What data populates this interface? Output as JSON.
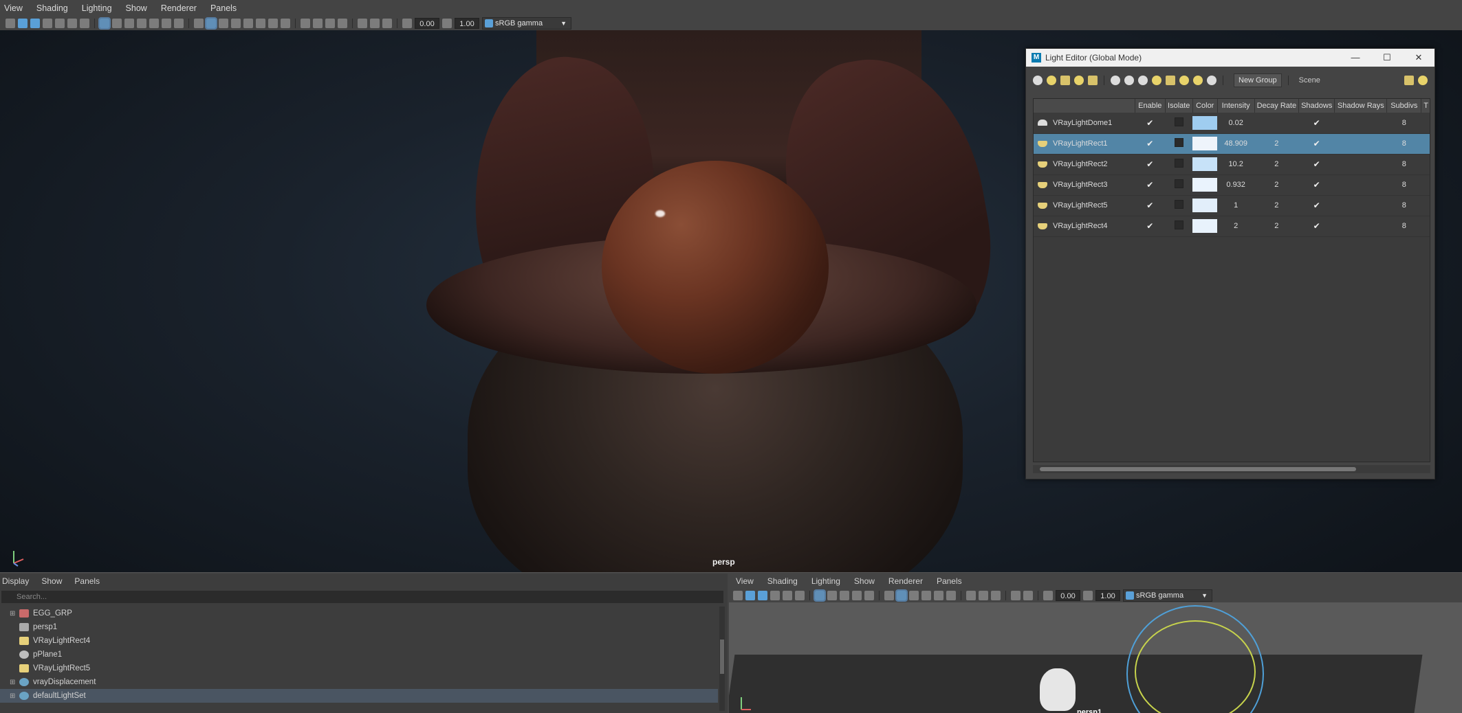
{
  "menu": [
    "View",
    "Shading",
    "Lighting",
    "Show",
    "Renderer",
    "Panels"
  ],
  "toolbar": {
    "exposure": "0.00",
    "gamma": "1.00",
    "colorspace": "sRGB gamma"
  },
  "viewport": {
    "camera_label": "persp"
  },
  "light_editor": {
    "title": "Light Editor (Global Mode)",
    "new_group": "New Group",
    "scene": "Scene",
    "columns": [
      "",
      "Enable",
      "Isolate",
      "Color",
      "Intensity",
      "Decay Rate",
      "Shadows",
      "Shadow Rays",
      "Subdivs",
      "T"
    ],
    "rows": [
      {
        "name": "VRayLightDome1",
        "intensity": "0.02",
        "decay": "",
        "subdivs": "8",
        "color": "#9fcdf0"
      },
      {
        "name": "VRayLightRect1",
        "intensity": "48.909",
        "decay": "2",
        "subdivs": "8",
        "color": "#eef4fb"
      },
      {
        "name": "VRayLightRect2",
        "intensity": "10.2",
        "decay": "2",
        "subdivs": "8",
        "color": "#c7e2f8"
      },
      {
        "name": "VRayLightRect3",
        "intensity": "0.932",
        "decay": "2",
        "subdivs": "8",
        "color": "#eaf3fd"
      },
      {
        "name": "VRayLightRect5",
        "intensity": "1",
        "decay": "2",
        "subdivs": "8",
        "color": "#e2eefa"
      },
      {
        "name": "VRayLightRect4",
        "intensity": "2",
        "decay": "2",
        "subdivs": "8",
        "color": "#e8f2fc"
      }
    ]
  },
  "outliner": {
    "menu": [
      "Display",
      "Show",
      "Panels"
    ],
    "search_placeholder": "Search...",
    "items": [
      {
        "label": "EGG_GRP",
        "icon": "group"
      },
      {
        "label": "persp1",
        "icon": "camera"
      },
      {
        "label": "VRayLightRect4",
        "icon": "light"
      },
      {
        "label": "pPlane1",
        "icon": "mesh"
      },
      {
        "label": "VRayLightRect5",
        "icon": "light"
      },
      {
        "label": "vrayDisplacement",
        "icon": "set"
      },
      {
        "label": "defaultLightSet",
        "icon": "set"
      }
    ]
  },
  "viewport2": {
    "menu": [
      "View",
      "Shading",
      "Lighting",
      "Show",
      "Renderer",
      "Panels"
    ],
    "exposure": "0.00",
    "gamma": "1.00",
    "colorspace": "sRGB gamma",
    "camera_label": "persp1"
  }
}
